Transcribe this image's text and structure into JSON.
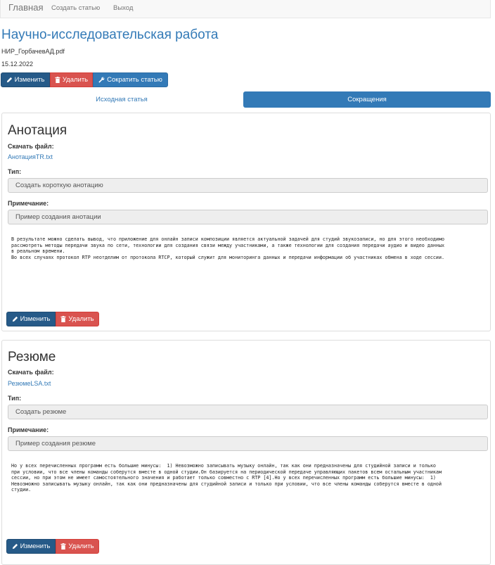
{
  "nav": {
    "brand": "Главная",
    "links": [
      "Создать статью",
      "Выход"
    ]
  },
  "page": {
    "title": "Научно-исследовательская работа",
    "filename": "НИР_ГорбачевАД.pdf",
    "date": "15.12.2022"
  },
  "toolbar": {
    "edit_label": "Изменить",
    "delete_label": "Удалить",
    "shorten_label": "Сократить статью"
  },
  "tabs": [
    {
      "label": "Исходная статья",
      "active": false
    },
    {
      "label": "Сокращения",
      "active": true
    }
  ],
  "sections": [
    {
      "title": "Анотация",
      "download_label": "Скачать файл:",
      "file_link": "АнотацияTR.txt",
      "type_label": "Тип:",
      "type_value": "Создать короткую анотацию",
      "note_label": "Примечание:",
      "note_value": "Пример создания анотации",
      "body": "В результате можно сделать вывод, что приложение для онлайн записи композиции является актуальной задачей для студий звукозаписи, но для этого необходимо\nрассмотреть методы передачи звука по сети, технологии для создания связи между участниками, а также технологии для создания передачи аудио и видео данных\nв реальном времени.\nВо всех случаях протокол RTP неотделим от протокола RTCP, который служит для мониторинга данных и передачи информации об участниках обмена в ходе сессии.",
      "edit_label": "Изменить",
      "delete_label": "Удалить"
    },
    {
      "title": "Резюме",
      "download_label": "Скачать файл:",
      "file_link": "РезюмеLSA.txt",
      "type_label": "Тип:",
      "type_value": "Создать резюме",
      "note_label": "Примечание:",
      "note_value": "Пример создания резюме",
      "body": "Но у всех перечисленных программ есть большие минусы:  1) Невозможно записывать музыку онлайн, так как они предназначены для студийной записи и только\nпри условии, что все члены команды соберутся вместе в одной студии.Он базируется на периодической передаче управляющих пакетов всем остальным участникам\nсессии, но при этом не имеет самостоятельного значения и работает только совместно с RTP [4].Но у всех перечисленных программ есть большие минусы:  1)\nНевозможно записывать музыку онлайн, так как они предназначены для студийной записи и только при условии, что все члены команды соберутся вместе в одной\nстудии.",
      "edit_label": "Изменить",
      "delete_label": "Удалить"
    }
  ],
  "colors": {
    "primary": "#337ab7",
    "primary_dark": "#265a88",
    "danger": "#d9534f",
    "field_bg": "#eeeeee"
  }
}
